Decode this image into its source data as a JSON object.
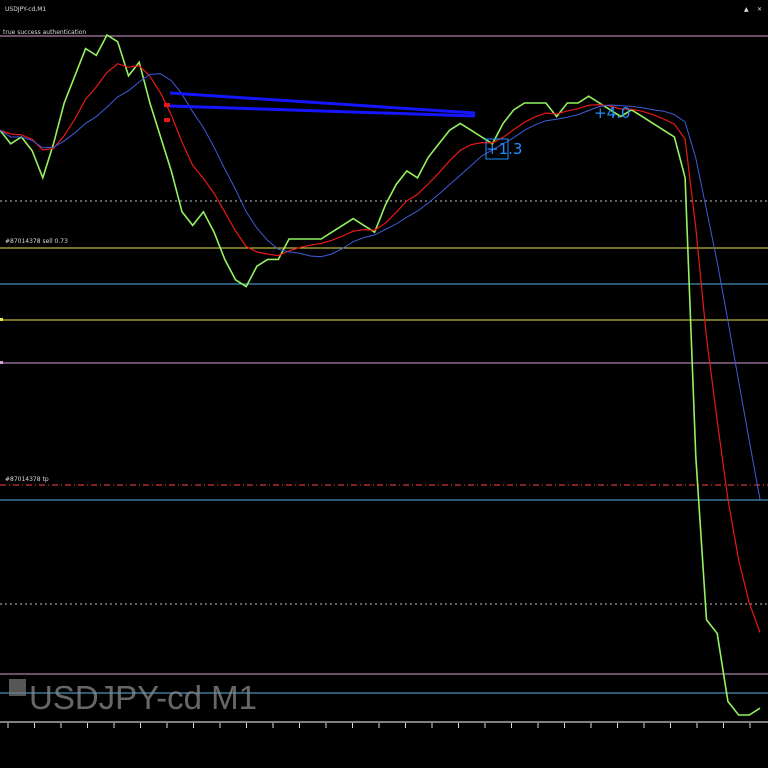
{
  "window": {
    "title": "USDJPY-cd,M1",
    "status_label": "true success authentication",
    "watermark": "USDJPY-cd M1"
  },
  "colors": {
    "background": "#000000",
    "grid_dotted": "#bfbfbf",
    "magenta": "#d49ed6",
    "yellow": "#e7e64a",
    "cyan": "#57b5e3",
    "red_dash": "#ff4040",
    "price": "#9dff63",
    "ema_fast": "#e81818",
    "ma_slow": "#3d5bd9",
    "trend": "#1515ff",
    "badge": "#1e90ff"
  },
  "order_labels": {
    "sell": "#87014378 sell 0.73",
    "tp": "#87014378 tp"
  },
  "badges": [
    {
      "text": "+1.3"
    },
    {
      "text": "+4.0"
    }
  ],
  "icons": {
    "close": "close-icon",
    "watermark": "symbol-icon"
  },
  "chart_data": {
    "type": "line",
    "series": [
      {
        "values": [
          0.86,
          0.84,
          0.85,
          0.83,
          0.79,
          0.84,
          0.9,
          0.94,
          0.98,
          0.97,
          1.0,
          0.99,
          0.94,
          0.96,
          0.9,
          0.85,
          0.8,
          0.74,
          0.72,
          0.74,
          0.71,
          0.67,
          0.64,
          0.63,
          0.66,
          0.67,
          0.67,
          0.7,
          0.7,
          0.7,
          0.7,
          0.71,
          0.72,
          0.73,
          0.72,
          0.71,
          0.75,
          0.78,
          0.8,
          0.79,
          0.82,
          0.84,
          0.86,
          0.87,
          0.86,
          0.85,
          0.84,
          0.87,
          0.89,
          0.9,
          0.9,
          0.9,
          0.88,
          0.9,
          0.9,
          0.91,
          0.9,
          0.89,
          0.88,
          0.89,
          0.88,
          0.87,
          0.86,
          0.85,
          0.79,
          0.38,
          0.14,
          0.12,
          0.02,
          0.0,
          0.0,
          0.01
        ]
      }
    ]
  }
}
